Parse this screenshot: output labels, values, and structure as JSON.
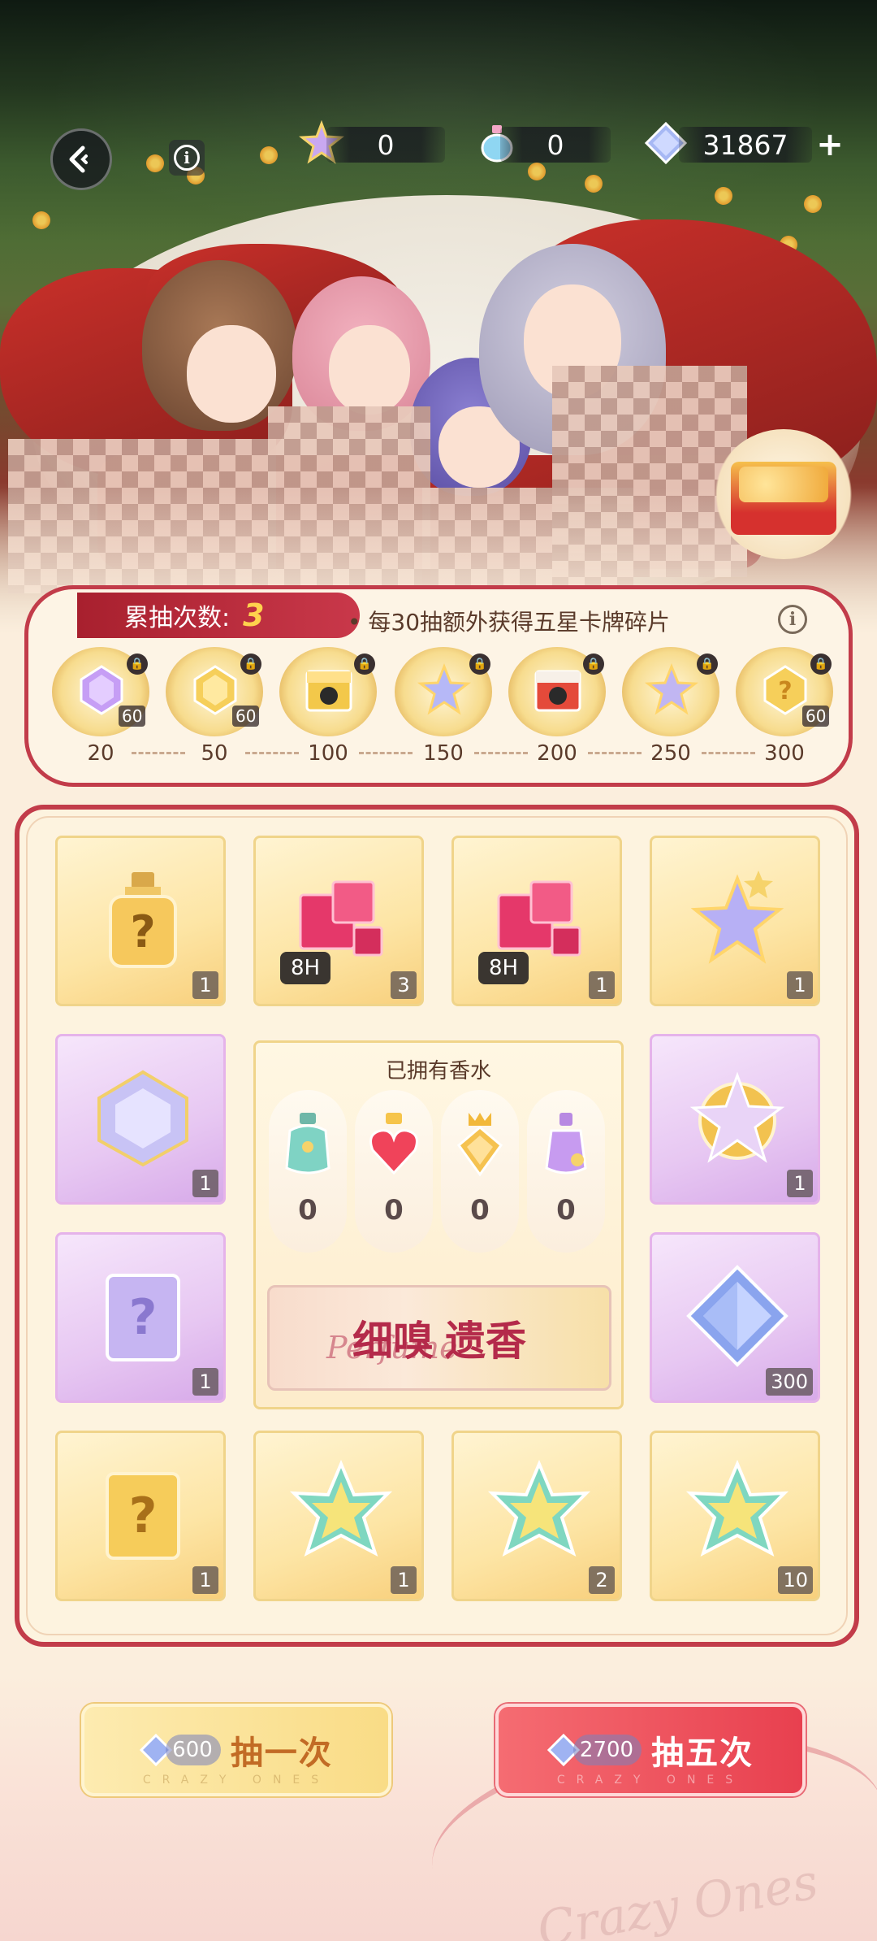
{
  "top_bar": {
    "resources": [
      {
        "icon": "star-ticket-icon",
        "value": "0"
      },
      {
        "icon": "perfume-bottle-icon",
        "value": "0"
      },
      {
        "icon": "diamond-icon",
        "value": "31867"
      }
    ],
    "plus_label": "+"
  },
  "progress": {
    "count_label": "累抽次数:",
    "count_value": "3",
    "bonus_text": "• 每30抽额外获得五星卡牌碎片",
    "milestones": [
      {
        "label": "20",
        "icon": "purple-crystal-icon",
        "qty": "60"
      },
      {
        "label": "50",
        "icon": "gold-crystal-icon",
        "qty": "60"
      },
      {
        "label": "100",
        "icon": "gold-chest-icon",
        "qty": ""
      },
      {
        "label": "150",
        "icon": "rainbow-star-icon",
        "qty": ""
      },
      {
        "label": "200",
        "icon": "red-chest-icon",
        "qty": ""
      },
      {
        "label": "250",
        "icon": "rainbow-star-icon",
        "qty": ""
      },
      {
        "label": "300",
        "icon": "gold-mystery-crystal-icon",
        "qty": "60"
      }
    ]
  },
  "rewards": {
    "row1": [
      {
        "icon": "mystery-perfume-icon",
        "qty": "1",
        "style": "gold",
        "time": ""
      },
      {
        "icon": "pink-cubes-icon",
        "qty": "3",
        "style": "gold",
        "time": "8H"
      },
      {
        "icon": "pink-cubes-icon",
        "qty": "1",
        "style": "gold",
        "time": "8H"
      },
      {
        "icon": "rainbow-stars-icon",
        "qty": "1",
        "style": "gold",
        "time": ""
      }
    ],
    "left_col": [
      {
        "icon": "lavender-crystal-box-icon",
        "qty": "1"
      },
      {
        "icon": "purple-mystery-card-icon",
        "qty": "1"
      }
    ],
    "right_col": [
      {
        "icon": "star-badge-icon",
        "qty": "1"
      },
      {
        "icon": "blue-diamond-icon",
        "qty": "300"
      }
    ],
    "row4": [
      {
        "icon": "gold-mystery-card-icon",
        "qty": "1"
      },
      {
        "icon": "rainbow-star-gem-icon",
        "qty": "1"
      },
      {
        "icon": "rainbow-star-gem-icon",
        "qty": "2"
      },
      {
        "icon": "rainbow-star-gem-icon",
        "qty": "10"
      }
    ]
  },
  "perfume_panel": {
    "title": "已拥有香水",
    "perfumes": [
      {
        "icon": "teal-pouch-perfume-icon",
        "count": "0"
      },
      {
        "icon": "red-heart-perfume-icon",
        "count": "0"
      },
      {
        "icon": "gold-crown-perfume-icon",
        "count": "0"
      },
      {
        "icon": "purple-perfume-icon",
        "count": "0"
      }
    ],
    "banner_main1": "细嗅",
    "banner_main2": "遗香",
    "banner_script": "Perfume"
  },
  "actions": {
    "draw_one_cost": "600",
    "draw_one_label": "抽一次",
    "draw_five_cost": "2700",
    "draw_five_label": "抽五次",
    "sub_text": "CRAZY ONES"
  },
  "decor": {
    "corner_script": "Crazy Ones"
  }
}
